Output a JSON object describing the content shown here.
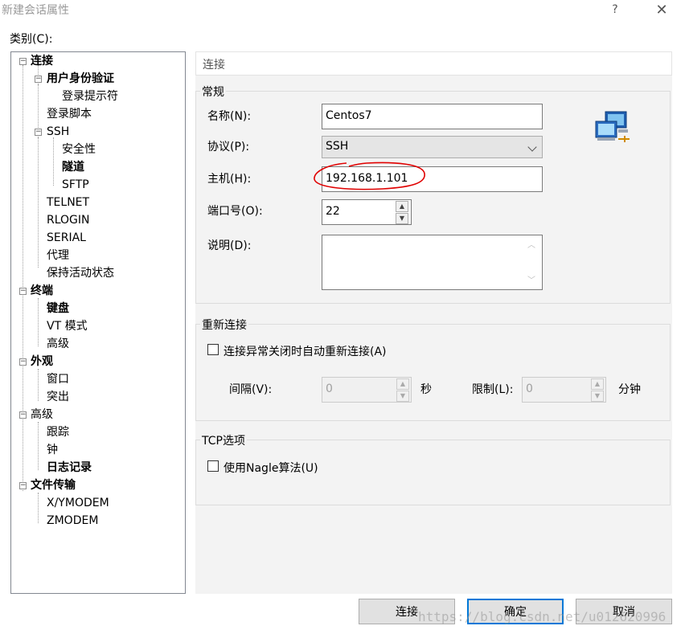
{
  "window": {
    "title": "新建会话属性",
    "help_glyph": "?",
    "close_glyph": "✕"
  },
  "category": {
    "label": "类别(C):",
    "items": [
      {
        "label": "连接",
        "bold": true
      },
      {
        "label": "用户身份验证",
        "bold": true
      },
      {
        "label": "登录提示符",
        "bold": false
      },
      {
        "label": "登录脚本",
        "bold": false
      },
      {
        "label": "SSH",
        "bold": false
      },
      {
        "label": "安全性",
        "bold": false
      },
      {
        "label": "隧道",
        "bold": true
      },
      {
        "label": "SFTP",
        "bold": false
      },
      {
        "label": "TELNET",
        "bold": false
      },
      {
        "label": "RLOGIN",
        "bold": false
      },
      {
        "label": "SERIAL",
        "bold": false
      },
      {
        "label": "代理",
        "bold": false
      },
      {
        "label": "保持活动状态",
        "bold": false
      },
      {
        "label": "终端",
        "bold": true
      },
      {
        "label": "键盘",
        "bold": true
      },
      {
        "label": "VT 模式",
        "bold": false
      },
      {
        "label": "高级",
        "bold": false
      },
      {
        "label": "外观",
        "bold": true
      },
      {
        "label": "窗口",
        "bold": false
      },
      {
        "label": "突出",
        "bold": false
      },
      {
        "label": "高级",
        "bold": false
      },
      {
        "label": "跟踪",
        "bold": false
      },
      {
        "label": "钟",
        "bold": false
      },
      {
        "label": "日志记录",
        "bold": true
      },
      {
        "label": "文件传输",
        "bold": true
      },
      {
        "label": "X/YMODEM",
        "bold": false
      },
      {
        "label": "ZMODEM",
        "bold": false
      }
    ]
  },
  "panel": {
    "header": "连接",
    "general": {
      "title": "常规",
      "name_label": "名称(N):",
      "name_value": "Centos7",
      "protocol_label": "协议(P):",
      "protocol_value": "SSH",
      "host_label": "主机(H):",
      "host_value": "192.168.1.101",
      "port_label": "端口号(O):",
      "port_value": "22",
      "desc_label": "说明(D):",
      "desc_value": ""
    },
    "reconnect": {
      "title": "重新连接",
      "auto_label": "连接异常关闭时自动重新连接(A)",
      "auto_checked": false,
      "interval_label": "间隔(V):",
      "interval_value": "0",
      "interval_unit": "秒",
      "limit_label": "限制(L):",
      "limit_value": "0",
      "limit_unit": "分钟"
    },
    "tcp": {
      "title": "TCP选项",
      "nagle_label": "使用Nagle算法(U)",
      "nagle_checked": false
    }
  },
  "buttons": {
    "connect": "连接",
    "ok": "确定",
    "cancel": "取消"
  },
  "watermark": "https://blog.csdn.net/u012620996",
  "colors": {
    "annotation_red": "#e00000",
    "panel_bg": "#f3f3f3",
    "default_button_border": "#0078d7"
  }
}
